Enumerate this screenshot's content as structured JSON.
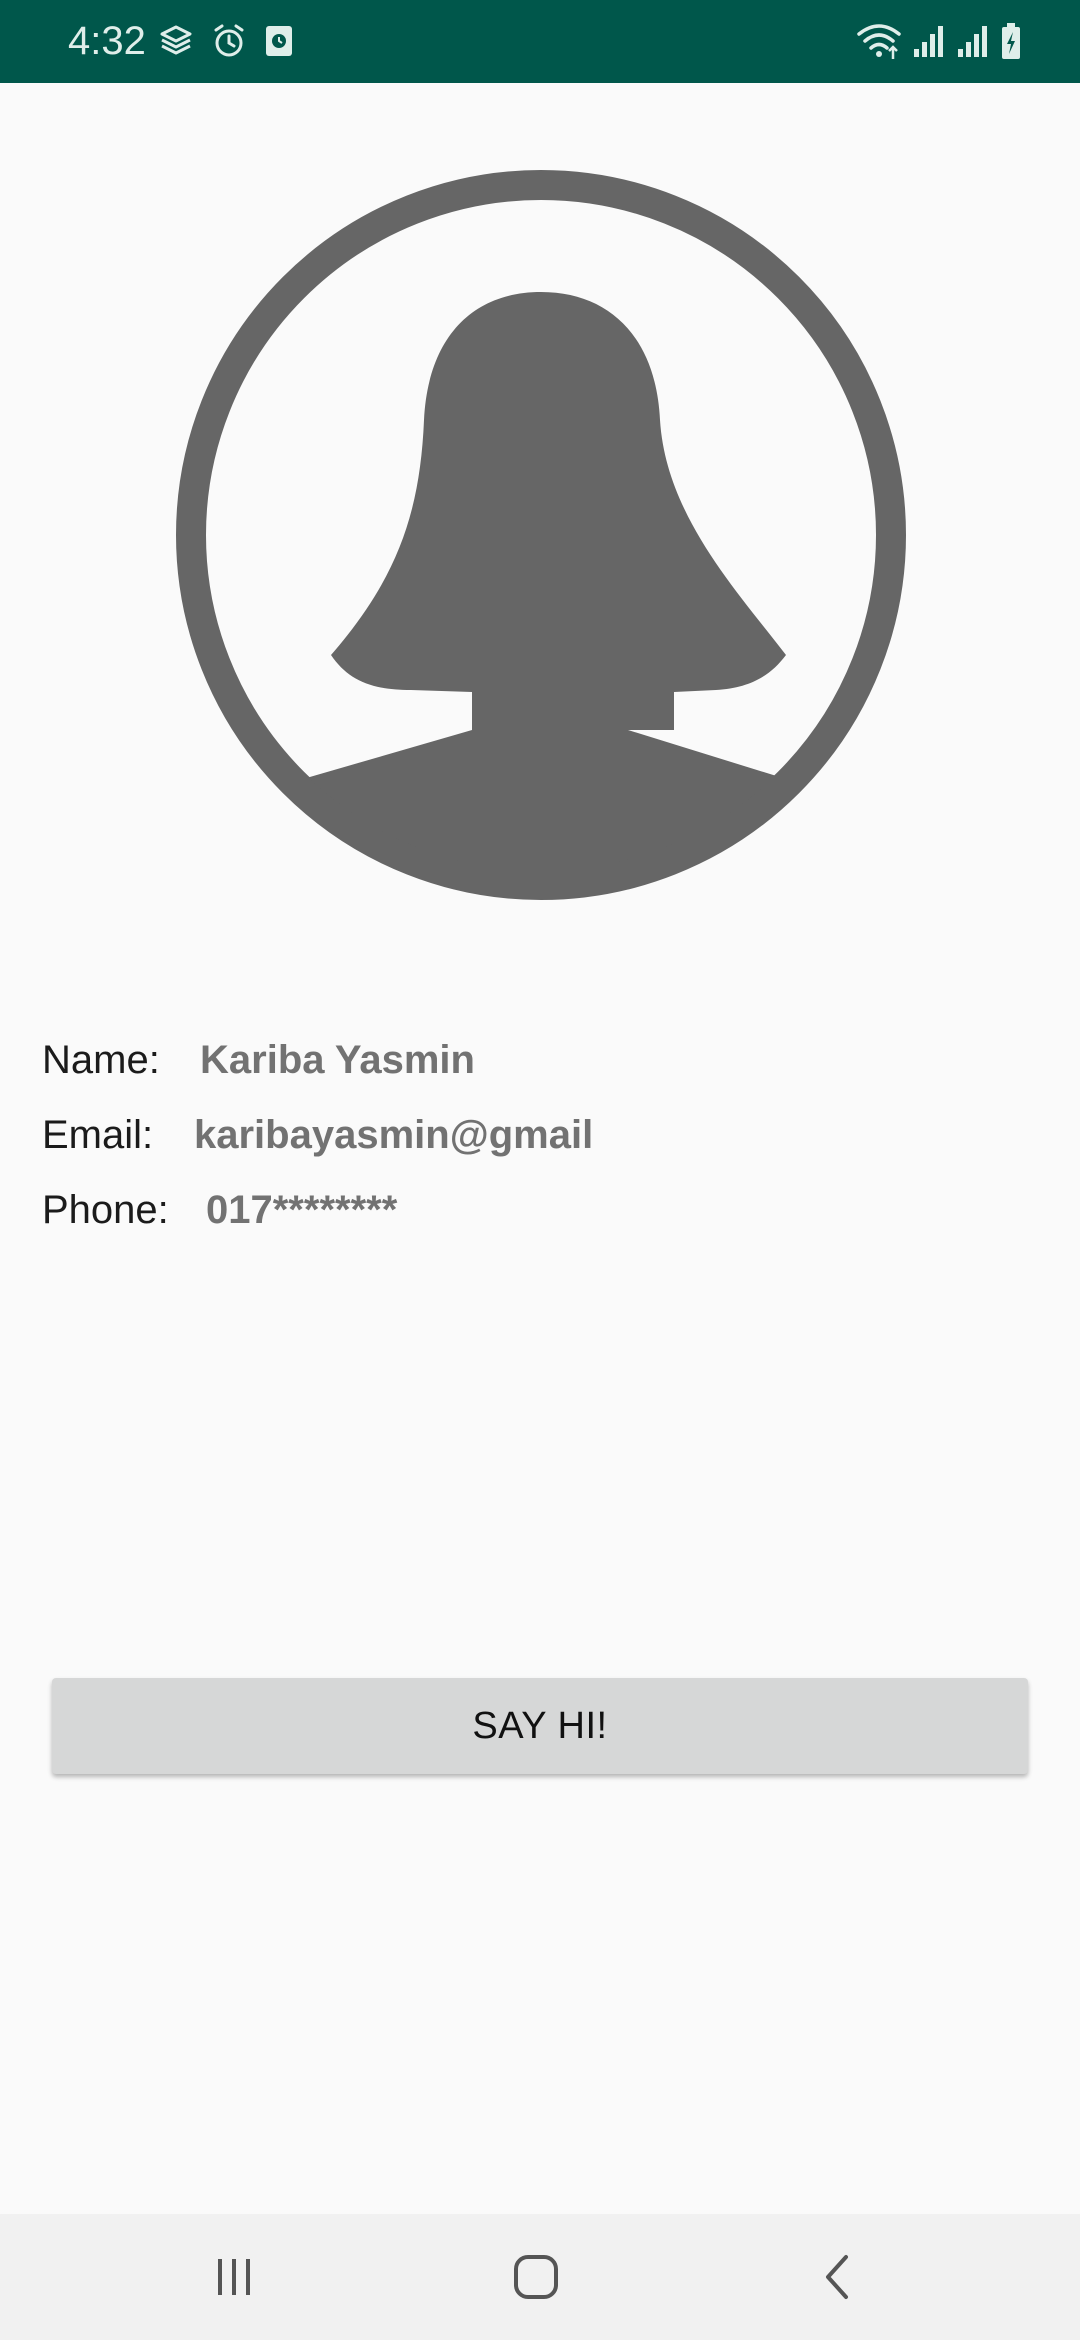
{
  "status_bar": {
    "time": "4:32",
    "left_icons": [
      "layers-icon",
      "alarm-icon",
      "screen-record-icon"
    ],
    "right_icons": [
      "wifi-icon",
      "signal-icon",
      "signal-icon",
      "battery-charging-icon"
    ],
    "background_color": "#00574b"
  },
  "profile": {
    "avatar_icon": "female-avatar-icon",
    "fields": {
      "name_label": "Name:",
      "name_value": "Kariba Yasmin",
      "email_label": "Email:",
      "email_value": "karibayasmin@gmail",
      "phone_label": "Phone:",
      "phone_value": "017********"
    }
  },
  "actions": {
    "say_hi_label": "SAY HI!"
  },
  "nav_bar": {
    "buttons": [
      "recent-apps-icon",
      "home-icon",
      "back-icon"
    ]
  }
}
